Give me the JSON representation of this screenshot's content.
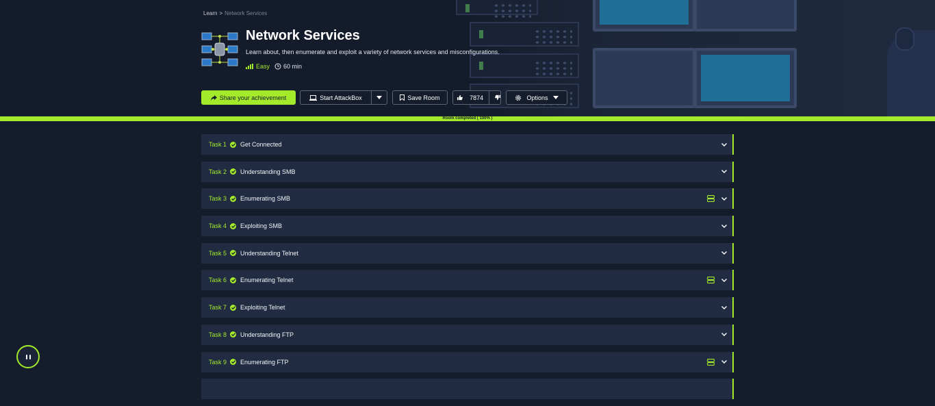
{
  "breadcrumb": {
    "root": "Learn",
    "separator": ">",
    "current": "Network Services"
  },
  "room": {
    "title": "Network Services",
    "description": "Learn about, then enumerate and exploit a variety of network services and misconfigurations.",
    "difficulty": "Easy",
    "duration": "60 min"
  },
  "actions": {
    "share_label": "Share your achievement",
    "attackbox_label": "Start AttackBox",
    "save_label": "Save Room",
    "votes": "7874",
    "options_label": "Options"
  },
  "progress": {
    "label": "Room completed ( 100% )",
    "percent": 100
  },
  "tasks": [
    {
      "num": "Task 1",
      "title": "Get Connected",
      "has_machine": false
    },
    {
      "num": "Task 2",
      "title": "Understanding SMB",
      "has_machine": false
    },
    {
      "num": "Task 3",
      "title": "Enumerating SMB",
      "has_machine": true
    },
    {
      "num": "Task 4",
      "title": "Exploiting SMB",
      "has_machine": false
    },
    {
      "num": "Task 5",
      "title": "Understanding Telnet",
      "has_machine": false
    },
    {
      "num": "Task 6",
      "title": "Enumerating Telnet",
      "has_machine": true
    },
    {
      "num": "Task 7",
      "title": "Exploiting Telnet",
      "has_machine": false
    },
    {
      "num": "Task 8",
      "title": "Understanding FTP",
      "has_machine": false
    },
    {
      "num": "Task 9",
      "title": "Enumerating FTP",
      "has_machine": true
    },
    {
      "num": "",
      "title": "",
      "has_machine": false
    }
  ],
  "colors": {
    "accent": "#a3ea2a",
    "background": "#151c2b",
    "card": "#212c42"
  },
  "icons": [
    "breadcrumb",
    "network-icon",
    "signal-bars-icon",
    "clock-icon",
    "share-icon",
    "laptop-icon",
    "bookmark-icon",
    "thumbs-up-icon",
    "thumbs-down-icon",
    "gear-icon",
    "chevron-down-icon",
    "check-circle-icon",
    "server-icon",
    "pause-icon"
  ]
}
